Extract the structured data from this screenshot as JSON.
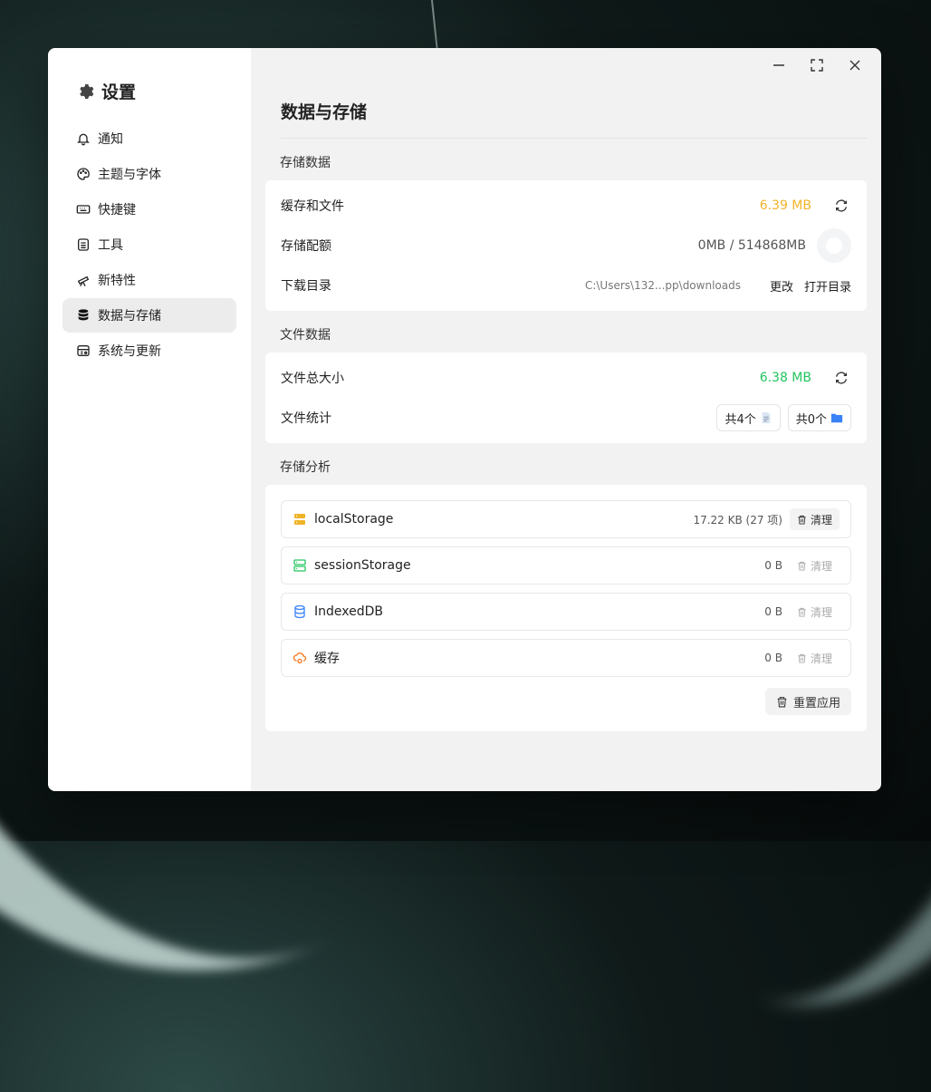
{
  "sidebar": {
    "title": "设置",
    "items": [
      {
        "label": "通知",
        "icon": "bell-icon",
        "active": false
      },
      {
        "label": "主题与字体",
        "icon": "palette-icon",
        "active": false
      },
      {
        "label": "快捷键",
        "icon": "keyboard-icon",
        "active": false
      },
      {
        "label": "工具",
        "icon": "tools-icon",
        "active": false
      },
      {
        "label": "新特性",
        "icon": "telescope-icon",
        "active": false
      },
      {
        "label": "数据与存储",
        "icon": "database-icon",
        "active": true
      },
      {
        "label": "系统与更新",
        "icon": "system-icon",
        "active": false
      }
    ]
  },
  "main": {
    "title": "数据与存储",
    "storage_section": {
      "label": "存储数据",
      "cache_label": "缓存和文件",
      "cache_value": "6.39 MB",
      "quota_label": "存储配额",
      "quota_value": "0MB / 514868MB",
      "download_label": "下载目录",
      "download_path": "C:\\Users\\132...pp\\downloads",
      "change_label": "更改",
      "open_label": "打开目录"
    },
    "file_section": {
      "label": "文件数据",
      "total_label": "文件总大小",
      "total_value": "6.38 MB",
      "stats_label": "文件统计",
      "files_count": "共4个",
      "folders_count": "共0个"
    },
    "analysis_section": {
      "label": "存储分析",
      "rows": [
        {
          "name": "localStorage",
          "size": "17.22 KB (27 项)",
          "clear": "清理",
          "enabled": true
        },
        {
          "name": "sessionStorage",
          "size": "0 B",
          "clear": "清理",
          "enabled": false
        },
        {
          "name": "IndexedDB",
          "size": "0 B",
          "clear": "清理",
          "enabled": false
        },
        {
          "name": "缓存",
          "size": "0 B",
          "clear": "清理",
          "enabled": false
        }
      ],
      "reset_label": "重置应用"
    }
  },
  "colors": {
    "warn": "#f0b429",
    "ok": "#22c55e",
    "folder": "#3b82f6"
  }
}
